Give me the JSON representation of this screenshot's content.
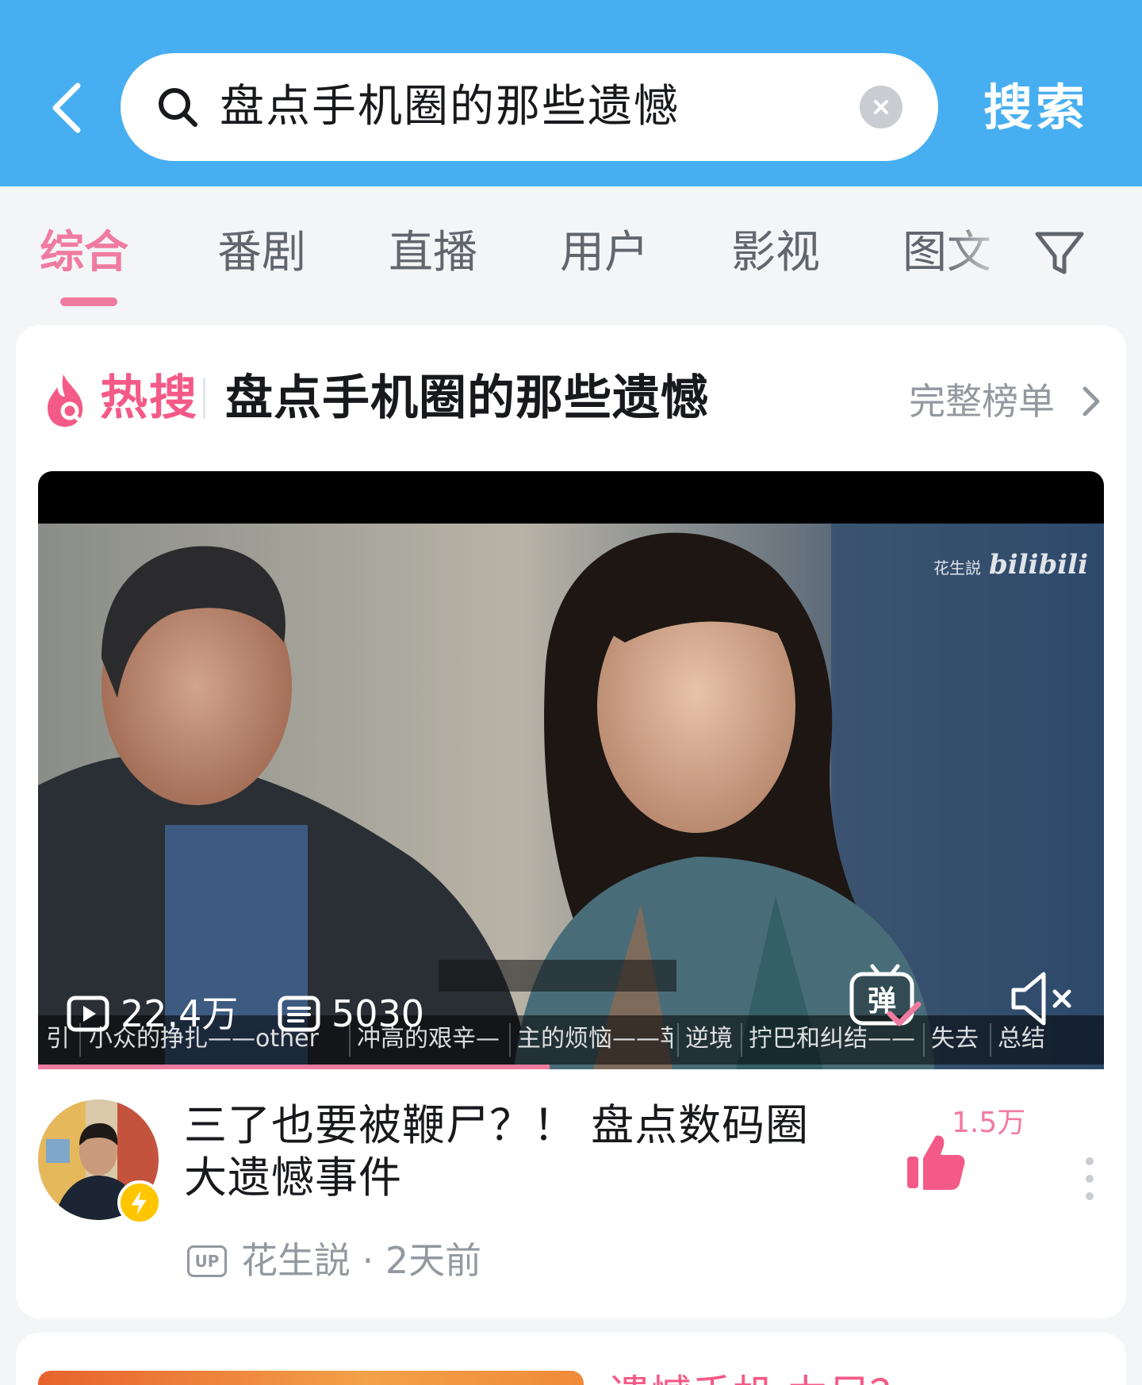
{
  "search": {
    "query": "盘点手机圈的那些遗憾",
    "submit_label": "搜索"
  },
  "tabs": [
    {
      "label": "综合",
      "active": true
    },
    {
      "label": "番剧",
      "active": false
    },
    {
      "label": "直播",
      "active": false
    },
    {
      "label": "用户",
      "active": false
    },
    {
      "label": "影视",
      "active": false
    },
    {
      "label": "图文",
      "active": false
    }
  ],
  "hot_search": {
    "label": "热搜",
    "title": "盘点手机圈的那些遗憾",
    "full_list_label": "完整榜单"
  },
  "video": {
    "watermark_name": "花生説",
    "watermark_logo": "bilibili",
    "views": "22.4万",
    "danmaku_count": "5030",
    "danmaku_label": "弹",
    "progress_fraction": 0.48,
    "chapters": [
      "引",
      "小众的挣扎——other",
      "冲高的艰辛—",
      "主的烦恼——苹",
      "逆境",
      "拧巴和纠结——",
      "失去",
      "总结"
    ]
  },
  "post": {
    "title": "三了也要被鞭尸？！ 盘点数码圈大遗憾事件",
    "likes": "1.5万",
    "up_badge": "UP",
    "uploader": "花生説",
    "time_ago": "2天前",
    "uploader_line": "花生説 · 2天前"
  },
  "next_card": {
    "title_fragment": "遗憾手机 力足？"
  },
  "colors": {
    "header_bg": "#47aff1",
    "accent_pink": "#f07ba0",
    "hot_red": "#f45a87",
    "page_bg": "#f4f5f7"
  }
}
